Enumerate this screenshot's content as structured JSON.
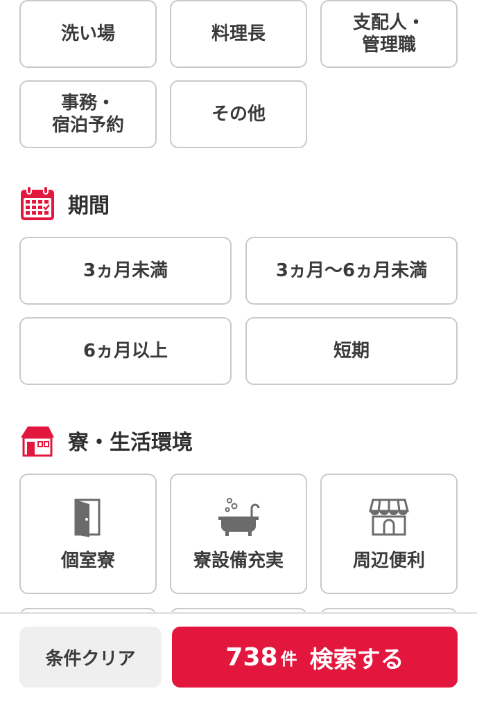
{
  "occupation": {
    "options": [
      "洗い場",
      "料理長",
      "支配人・\n管理職",
      "事務・\n宿泊予約",
      "その他"
    ]
  },
  "period": {
    "title": "期間",
    "icon": "calendar-icon",
    "options": [
      "3ヵ月未満",
      "3ヵ月〜6ヵ月未満",
      "6ヵ月以上",
      "短期"
    ]
  },
  "dorm": {
    "title": "寮・生活環境",
    "icon": "house-icon",
    "options": [
      {
        "label": "個室寮",
        "icon": "door-icon"
      },
      {
        "label": "寮設備充実",
        "icon": "bathtub-icon"
      },
      {
        "label": "周辺便利",
        "icon": "store-icon"
      }
    ]
  },
  "footer": {
    "clear_label": "条件クリア",
    "count": "738",
    "count_unit": "件",
    "search_label": "検索する"
  },
  "colors": {
    "accent": "#e3173e",
    "border": "#c9c9c9",
    "icon_gray": "#6b6b6b"
  }
}
